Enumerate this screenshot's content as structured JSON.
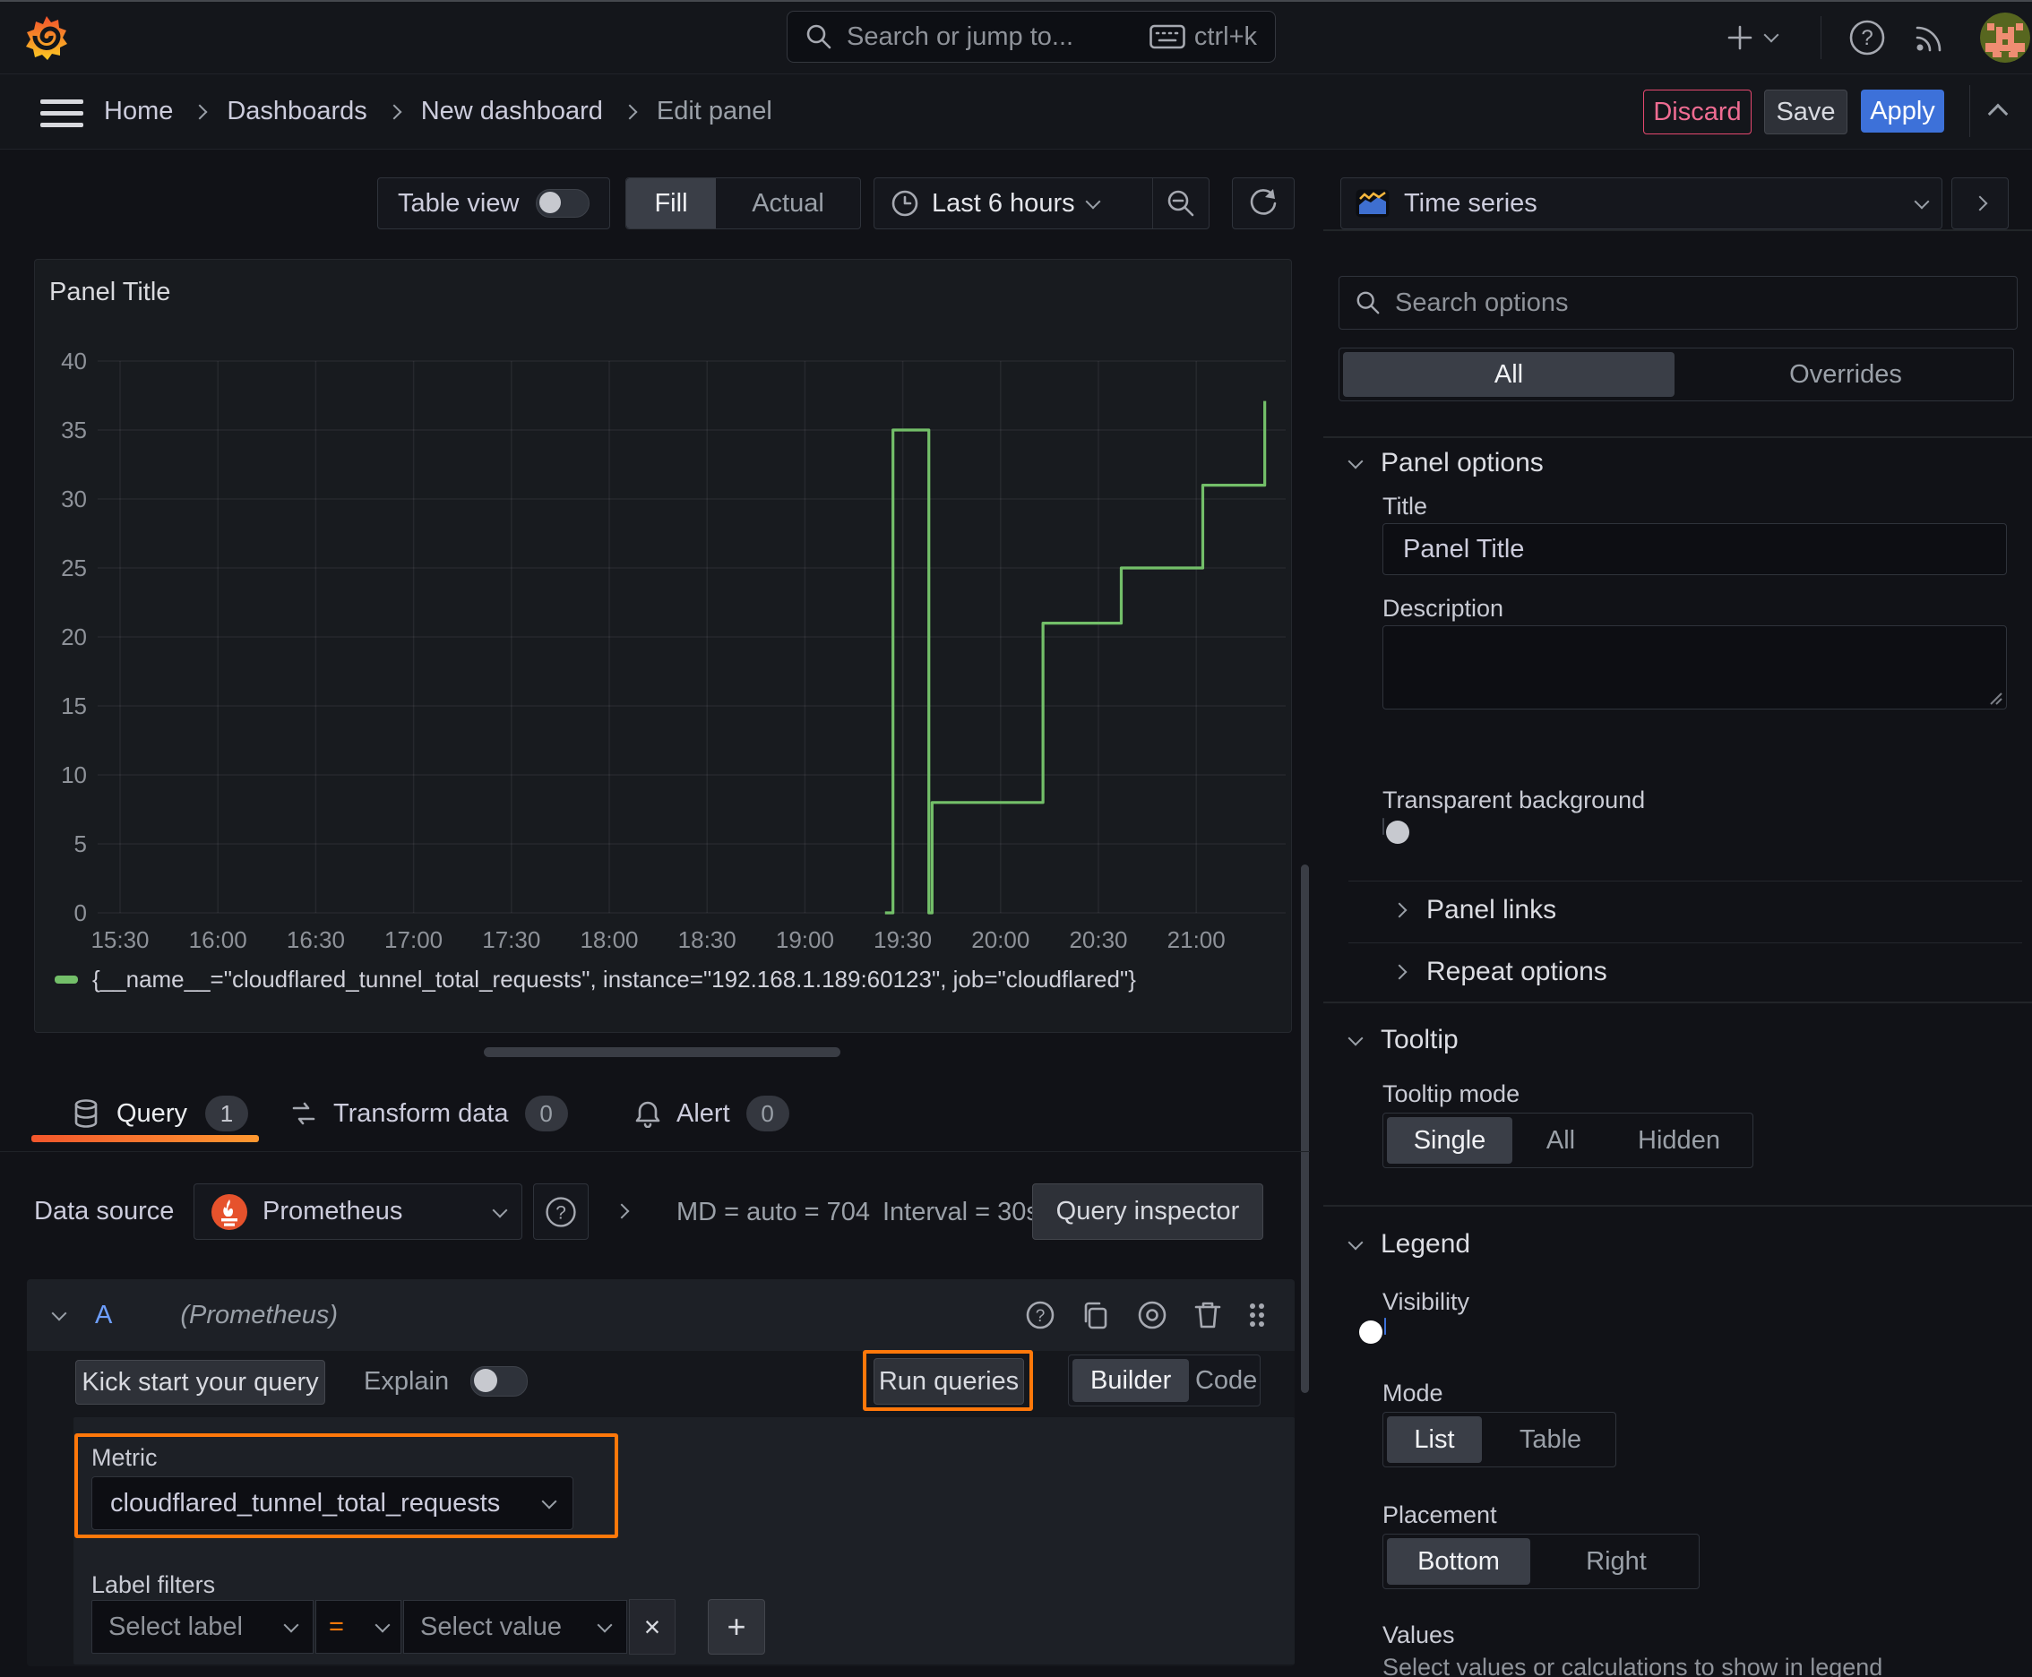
{
  "topbar": {
    "search_placeholder": "Search or jump to...",
    "shortcut": "ctrl+k"
  },
  "breadcrumb": {
    "items": [
      "Home",
      "Dashboards",
      "New dashboard",
      "Edit panel"
    ]
  },
  "actions": {
    "discard": "Discard",
    "save": "Save",
    "apply": "Apply"
  },
  "panel_toolbar": {
    "table_view": "Table view",
    "fill": "Fill",
    "actual": "Actual",
    "time_range": "Last 6 hours"
  },
  "viz_picker": {
    "name": "Time series"
  },
  "panel": {
    "title": "Panel Title"
  },
  "chart_data": {
    "type": "line",
    "mode": "step-after",
    "title": "Panel Title",
    "x_ticks": [
      "15:30",
      "16:00",
      "16:30",
      "17:00",
      "17:30",
      "18:00",
      "18:30",
      "19:00",
      "19:30",
      "20:00",
      "20:30",
      "21:00"
    ],
    "y_ticks": [
      0,
      5,
      10,
      15,
      20,
      25,
      30,
      35,
      40
    ],
    "ylim": [
      0,
      40
    ],
    "grid": true,
    "legend_position": "bottom",
    "series": [
      {
        "name": "{__name__=\"cloudflared_tunnel_total_requests\", instance=\"192.168.1.189:60123\", job=\"cloudflared\"}",
        "color": "#73bf69",
        "points": [
          [
            "19:25",
            0
          ],
          [
            "19:27",
            35
          ],
          [
            "19:38",
            0
          ],
          [
            "19:39",
            8
          ],
          [
            "20:13",
            21
          ],
          [
            "20:37",
            25
          ],
          [
            "21:02",
            31
          ],
          [
            "21:21",
            37
          ]
        ]
      }
    ]
  },
  "tabs": {
    "query": "Query",
    "query_count": "1",
    "transform": "Transform data",
    "transform_count": "0",
    "alert": "Alert",
    "alert_count": "0"
  },
  "datasource": {
    "label": "Data source",
    "name": "Prometheus",
    "stats_md": "MD = auto = 704",
    "stats_interval": "Interval = 30s",
    "inspector": "Query inspector"
  },
  "query_editor": {
    "ref_id": "A",
    "ds_hint": "(Prometheus)",
    "kickstart": "Kick start your query",
    "explain": "Explain",
    "run": "Run queries",
    "builder": "Builder",
    "code": "Code",
    "metric_label": "Metric",
    "metric_value": "cloudflared_tunnel_total_requests",
    "label_filters": "Label filters",
    "select_label": "Select label",
    "operator": "=",
    "select_value": "Select value"
  },
  "options": {
    "search_placeholder": "Search options",
    "tabs": {
      "all": "All",
      "overrides": "Overrides"
    },
    "panel_options": {
      "title": "Panel options",
      "title_label": "Title",
      "title_value": "Panel Title",
      "description_label": "Description",
      "transparent_label": "Transparent background",
      "panel_links": "Panel links",
      "repeat_options": "Repeat options"
    },
    "tooltip": {
      "title": "Tooltip",
      "mode_label": "Tooltip mode",
      "modes": [
        "Single",
        "All",
        "Hidden"
      ],
      "active": "Single"
    },
    "legend": {
      "title": "Legend",
      "visibility_label": "Visibility",
      "mode_label": "Mode",
      "modes": [
        "List",
        "Table"
      ],
      "active_mode": "List",
      "placement_label": "Placement",
      "placements": [
        "Bottom",
        "Right"
      ],
      "active_placement": "Bottom",
      "values_label": "Values",
      "values_hint": "Select values or calculations to show in legend"
    }
  },
  "icons": {
    "close": "×",
    "add": "+",
    "question": "?"
  },
  "colors": {
    "accent_orange": "#ff780a",
    "series_green": "#73bf69",
    "primary_blue": "#3d71d9",
    "danger_pink": "#e5486f"
  }
}
